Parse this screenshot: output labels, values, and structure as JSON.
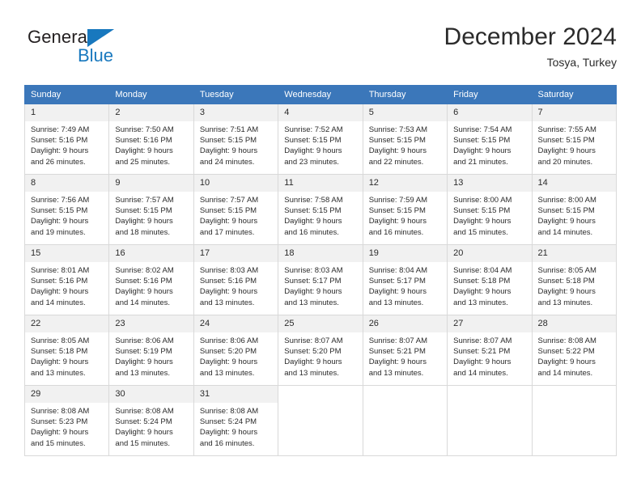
{
  "brand": {
    "word_one": "General",
    "word_two": "Blue",
    "triangle_color": "#1878be",
    "text_color": "#231f20"
  },
  "header": {
    "title": "December 2024",
    "subtitle": "Tosya, Turkey"
  },
  "calendar": {
    "header_bg": "#3b77ba",
    "daynum_bg": "#f1f1f1",
    "weekdays": [
      "Sunday",
      "Monday",
      "Tuesday",
      "Wednesday",
      "Thursday",
      "Friday",
      "Saturday"
    ],
    "weeks": [
      [
        {
          "day": "1",
          "sunrise": "Sunrise: 7:49 AM",
          "sunset": "Sunset: 5:16 PM",
          "daylight_1": "Daylight: 9 hours",
          "daylight_2": "and 26 minutes."
        },
        {
          "day": "2",
          "sunrise": "Sunrise: 7:50 AM",
          "sunset": "Sunset: 5:16 PM",
          "daylight_1": "Daylight: 9 hours",
          "daylight_2": "and 25 minutes."
        },
        {
          "day": "3",
          "sunrise": "Sunrise: 7:51 AM",
          "sunset": "Sunset: 5:15 PM",
          "daylight_1": "Daylight: 9 hours",
          "daylight_2": "and 24 minutes."
        },
        {
          "day": "4",
          "sunrise": "Sunrise: 7:52 AM",
          "sunset": "Sunset: 5:15 PM",
          "daylight_1": "Daylight: 9 hours",
          "daylight_2": "and 23 minutes."
        },
        {
          "day": "5",
          "sunrise": "Sunrise: 7:53 AM",
          "sunset": "Sunset: 5:15 PM",
          "daylight_1": "Daylight: 9 hours",
          "daylight_2": "and 22 minutes."
        },
        {
          "day": "6",
          "sunrise": "Sunrise: 7:54 AM",
          "sunset": "Sunset: 5:15 PM",
          "daylight_1": "Daylight: 9 hours",
          "daylight_2": "and 21 minutes."
        },
        {
          "day": "7",
          "sunrise": "Sunrise: 7:55 AM",
          "sunset": "Sunset: 5:15 PM",
          "daylight_1": "Daylight: 9 hours",
          "daylight_2": "and 20 minutes."
        }
      ],
      [
        {
          "day": "8",
          "sunrise": "Sunrise: 7:56 AM",
          "sunset": "Sunset: 5:15 PM",
          "daylight_1": "Daylight: 9 hours",
          "daylight_2": "and 19 minutes."
        },
        {
          "day": "9",
          "sunrise": "Sunrise: 7:57 AM",
          "sunset": "Sunset: 5:15 PM",
          "daylight_1": "Daylight: 9 hours",
          "daylight_2": "and 18 minutes."
        },
        {
          "day": "10",
          "sunrise": "Sunrise: 7:57 AM",
          "sunset": "Sunset: 5:15 PM",
          "daylight_1": "Daylight: 9 hours",
          "daylight_2": "and 17 minutes."
        },
        {
          "day": "11",
          "sunrise": "Sunrise: 7:58 AM",
          "sunset": "Sunset: 5:15 PM",
          "daylight_1": "Daylight: 9 hours",
          "daylight_2": "and 16 minutes."
        },
        {
          "day": "12",
          "sunrise": "Sunrise: 7:59 AM",
          "sunset": "Sunset: 5:15 PM",
          "daylight_1": "Daylight: 9 hours",
          "daylight_2": "and 16 minutes."
        },
        {
          "day": "13",
          "sunrise": "Sunrise: 8:00 AM",
          "sunset": "Sunset: 5:15 PM",
          "daylight_1": "Daylight: 9 hours",
          "daylight_2": "and 15 minutes."
        },
        {
          "day": "14",
          "sunrise": "Sunrise: 8:00 AM",
          "sunset": "Sunset: 5:15 PM",
          "daylight_1": "Daylight: 9 hours",
          "daylight_2": "and 14 minutes."
        }
      ],
      [
        {
          "day": "15",
          "sunrise": "Sunrise: 8:01 AM",
          "sunset": "Sunset: 5:16 PM",
          "daylight_1": "Daylight: 9 hours",
          "daylight_2": "and 14 minutes."
        },
        {
          "day": "16",
          "sunrise": "Sunrise: 8:02 AM",
          "sunset": "Sunset: 5:16 PM",
          "daylight_1": "Daylight: 9 hours",
          "daylight_2": "and 14 minutes."
        },
        {
          "day": "17",
          "sunrise": "Sunrise: 8:03 AM",
          "sunset": "Sunset: 5:16 PM",
          "daylight_1": "Daylight: 9 hours",
          "daylight_2": "and 13 minutes."
        },
        {
          "day": "18",
          "sunrise": "Sunrise: 8:03 AM",
          "sunset": "Sunset: 5:17 PM",
          "daylight_1": "Daylight: 9 hours",
          "daylight_2": "and 13 minutes."
        },
        {
          "day": "19",
          "sunrise": "Sunrise: 8:04 AM",
          "sunset": "Sunset: 5:17 PM",
          "daylight_1": "Daylight: 9 hours",
          "daylight_2": "and 13 minutes."
        },
        {
          "day": "20",
          "sunrise": "Sunrise: 8:04 AM",
          "sunset": "Sunset: 5:18 PM",
          "daylight_1": "Daylight: 9 hours",
          "daylight_2": "and 13 minutes."
        },
        {
          "day": "21",
          "sunrise": "Sunrise: 8:05 AM",
          "sunset": "Sunset: 5:18 PM",
          "daylight_1": "Daylight: 9 hours",
          "daylight_2": "and 13 minutes."
        }
      ],
      [
        {
          "day": "22",
          "sunrise": "Sunrise: 8:05 AM",
          "sunset": "Sunset: 5:18 PM",
          "daylight_1": "Daylight: 9 hours",
          "daylight_2": "and 13 minutes."
        },
        {
          "day": "23",
          "sunrise": "Sunrise: 8:06 AM",
          "sunset": "Sunset: 5:19 PM",
          "daylight_1": "Daylight: 9 hours",
          "daylight_2": "and 13 minutes."
        },
        {
          "day": "24",
          "sunrise": "Sunrise: 8:06 AM",
          "sunset": "Sunset: 5:20 PM",
          "daylight_1": "Daylight: 9 hours",
          "daylight_2": "and 13 minutes."
        },
        {
          "day": "25",
          "sunrise": "Sunrise: 8:07 AM",
          "sunset": "Sunset: 5:20 PM",
          "daylight_1": "Daylight: 9 hours",
          "daylight_2": "and 13 minutes."
        },
        {
          "day": "26",
          "sunrise": "Sunrise: 8:07 AM",
          "sunset": "Sunset: 5:21 PM",
          "daylight_1": "Daylight: 9 hours",
          "daylight_2": "and 13 minutes."
        },
        {
          "day": "27",
          "sunrise": "Sunrise: 8:07 AM",
          "sunset": "Sunset: 5:21 PM",
          "daylight_1": "Daylight: 9 hours",
          "daylight_2": "and 14 minutes."
        },
        {
          "day": "28",
          "sunrise": "Sunrise: 8:08 AM",
          "sunset": "Sunset: 5:22 PM",
          "daylight_1": "Daylight: 9 hours",
          "daylight_2": "and 14 minutes."
        }
      ],
      [
        {
          "day": "29",
          "sunrise": "Sunrise: 8:08 AM",
          "sunset": "Sunset: 5:23 PM",
          "daylight_1": "Daylight: 9 hours",
          "daylight_2": "and 15 minutes."
        },
        {
          "day": "30",
          "sunrise": "Sunrise: 8:08 AM",
          "sunset": "Sunset: 5:24 PM",
          "daylight_1": "Daylight: 9 hours",
          "daylight_2": "and 15 minutes."
        },
        {
          "day": "31",
          "sunrise": "Sunrise: 8:08 AM",
          "sunset": "Sunset: 5:24 PM",
          "daylight_1": "Daylight: 9 hours",
          "daylight_2": "and 16 minutes."
        },
        {
          "day": "",
          "sunrise": "",
          "sunset": "",
          "daylight_1": "",
          "daylight_2": ""
        },
        {
          "day": "",
          "sunrise": "",
          "sunset": "",
          "daylight_1": "",
          "daylight_2": ""
        },
        {
          "day": "",
          "sunrise": "",
          "sunset": "",
          "daylight_1": "",
          "daylight_2": ""
        },
        {
          "day": "",
          "sunrise": "",
          "sunset": "",
          "daylight_1": "",
          "daylight_2": ""
        }
      ]
    ]
  }
}
